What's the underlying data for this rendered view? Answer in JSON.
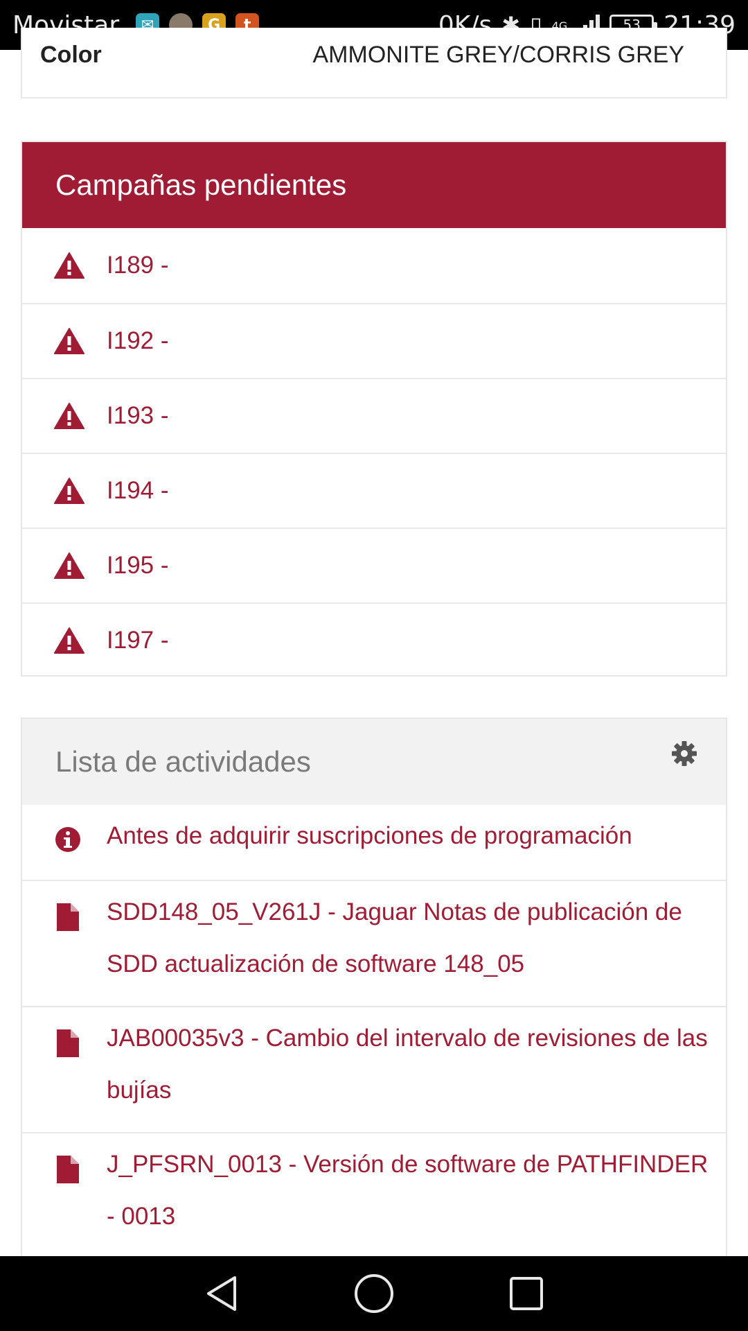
{
  "status_bar": {
    "carrier": "Movistar",
    "speed": "0K/s",
    "network": "4G",
    "battery": "53",
    "time": "21:39",
    "app_icons": [
      "mail-icon",
      "avatar-icon",
      "g-app-icon",
      "t-app-icon"
    ],
    "app_letters": {
      "g": "G",
      "t": "t"
    }
  },
  "vehicle": {
    "color_label": "Color",
    "color_value": "AMMONITE GREY/CORRIS GREY"
  },
  "campaigns": {
    "title": "Campañas pendientes",
    "items": [
      "I189 -",
      "I192 -",
      "I193 -",
      "I194 -",
      "I195 -",
      "I197 -"
    ]
  },
  "activities": {
    "title": "Lista de actividades",
    "items": [
      {
        "icon": "info-icon",
        "text": "Antes de adquirir suscripciones de programación"
      },
      {
        "icon": "document-icon",
        "text": "SDD148_05_V261J - Jaguar Notas de publicación de SDD actualización de software 148_05"
      },
      {
        "icon": "document-icon",
        "text": "JAB00035v3 - Cambio del intervalo de revisiones de las bujías"
      },
      {
        "icon": "document-icon",
        "text": "J_PFSRN_0013 - Versión de software de PATHFINDER - 0013"
      }
    ]
  },
  "colors": {
    "accent": "#a01c35",
    "header_grey": "#f2f2f2",
    "muted_text": "#7a7a7a"
  }
}
